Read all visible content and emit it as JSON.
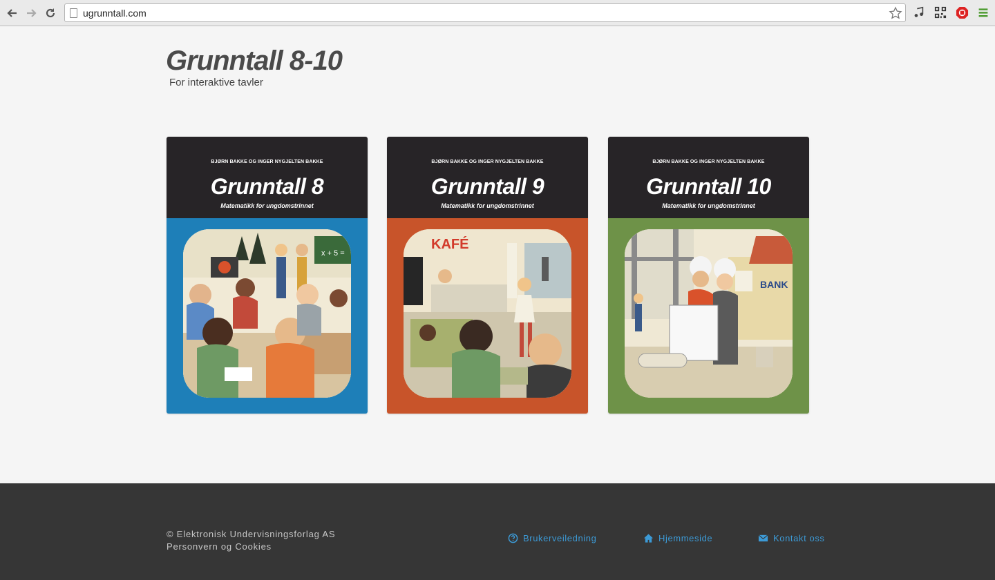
{
  "browser": {
    "url": "ugrunntall.com"
  },
  "header": {
    "title": "Grunntall 8-10",
    "subtitle": "For interaktive tavler"
  },
  "books": [
    {
      "authors": "BJØRN BAKKE OG INGER NYGJELTEN BAKKE",
      "title": "Grunntall 8",
      "subtitle": "Matematikk for ungdomstrinnet",
      "color": "#1e7fb8"
    },
    {
      "authors": "BJØRN BAKKE OG INGER NYGJELTEN BAKKE",
      "title": "Grunntall 9",
      "subtitle": "Matematikk for ungdomstrinnet",
      "color": "#c8542a"
    },
    {
      "authors": "BJØRN BAKKE OG INGER NYGJELTEN BAKKE",
      "title": "Grunntall 10",
      "subtitle": "Matematikk for ungdomstrinnet",
      "color": "#6e9248"
    }
  ],
  "footer": {
    "copyright": "© Elektronisk Undervisningsforlag AS",
    "privacy": "Personvern og Cookies",
    "links": [
      {
        "label": "Brukerveiledning",
        "icon": "question-circle-icon"
      },
      {
        "label": "Hjemmeside",
        "icon": "home-icon"
      },
      {
        "label": "Kontakt oss",
        "icon": "envelope-icon"
      }
    ],
    "link_color": "#3c9ad6"
  }
}
